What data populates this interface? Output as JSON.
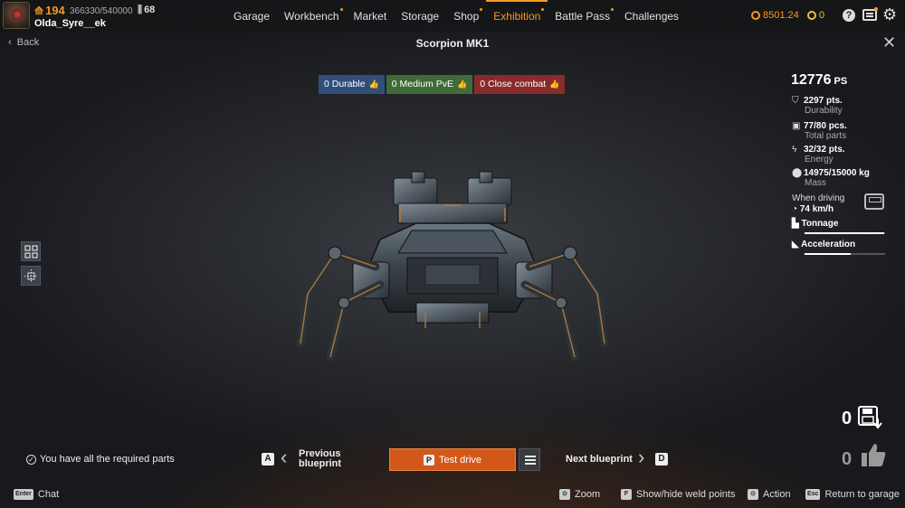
{
  "player": {
    "level": "194",
    "xp": "366330/540000",
    "rank": "68",
    "name": "Olda_Syre__ek"
  },
  "nav": {
    "items": [
      {
        "label": "Garage",
        "dot": false,
        "active": false
      },
      {
        "label": "Workbench",
        "dot": true,
        "active": false
      },
      {
        "label": "Market",
        "dot": false,
        "active": false
      },
      {
        "label": "Storage",
        "dot": false,
        "active": false
      },
      {
        "label": "Shop",
        "dot": true,
        "active": false
      },
      {
        "label": "Exhibition",
        "dot": true,
        "active": true
      },
      {
        "label": "Battle Pass",
        "dot": true,
        "active": false
      },
      {
        "label": "Challenges",
        "dot": false,
        "active": false
      }
    ]
  },
  "currency": {
    "coins": "8501.24",
    "gold": "0"
  },
  "header": {
    "back_label": "Back",
    "title": "Scorpion MK1"
  },
  "tags": {
    "durable": "0 Durable",
    "pve": "0 Medium PvE",
    "close": "0 Close combat"
  },
  "stats": {
    "ps_value": "12776",
    "ps_unit": "PS",
    "durability_value": "2297 pts.",
    "durability_label": "Durability",
    "parts_value": "77/80 pcs.",
    "parts_label": "Total parts",
    "energy_value": "32/32 pts.",
    "energy_label": "Energy",
    "mass_value": "14975/15000 kg",
    "mass_label": "Mass",
    "driving_label": "When driving",
    "speed_value": "74 km/h",
    "tonnage_label": "Tonnage",
    "tonnage_fraction": 0.99,
    "acceleration_label": "Acceleration",
    "acceleration_fraction": 0.57
  },
  "bottom": {
    "required_parts": "You have all the required parts",
    "prev_key": "A",
    "prev_label": "Previous blueprint",
    "test_key": "P",
    "test_label": "Test drive",
    "next_label": "Next blueprint",
    "next_key": "D",
    "saves_count": "0",
    "likes_count": "0"
  },
  "footer": {
    "chat_key": "Enter",
    "chat_label": "Chat",
    "zoom_label": "Zoom",
    "weld_key": "F",
    "weld_label": "Show/hide weld points",
    "action_label": "Action",
    "return_key": "Esc",
    "return_label": "Return to garage"
  },
  "colors": {
    "accent": "#f59a23",
    "durable_tag": "#2f4f7a",
    "pve_tag": "#3e6b37",
    "close_tag": "#8a2b2b",
    "test_drive": "#d2581a"
  }
}
